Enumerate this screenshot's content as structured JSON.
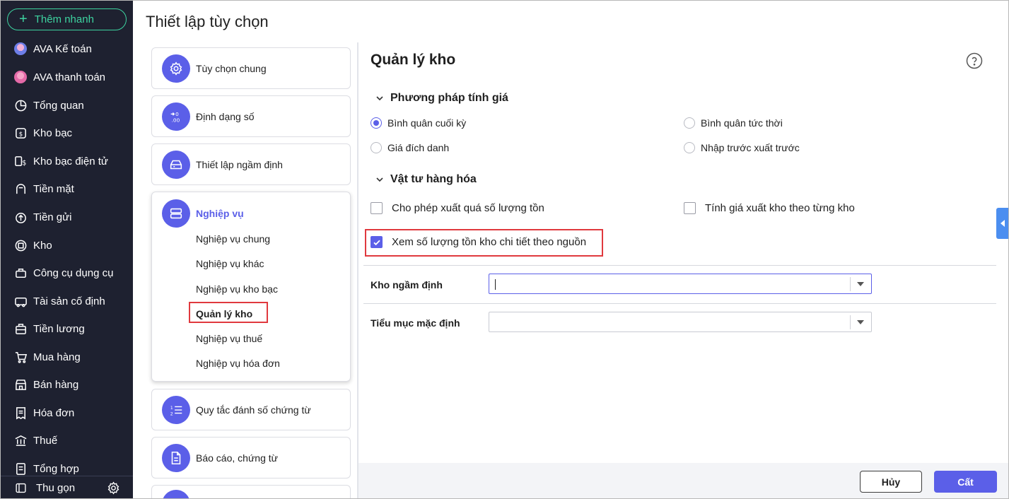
{
  "sidebar": {
    "quick_add": "Thêm nhanh",
    "items": [
      {
        "label": "AVA Kế toán",
        "icon": "ava-accounting-avatar-icon"
      },
      {
        "label": "AVA thanh toán",
        "icon": "ava-payment-avatar-icon"
      },
      {
        "label": "Tổng quan",
        "icon": "pie-chart-icon"
      },
      {
        "label": "Kho bạc",
        "icon": "treasury-coin-icon"
      },
      {
        "label": "Kho bạc điện tử",
        "icon": "e-treasury-icon"
      },
      {
        "label": "Tiền mặt",
        "icon": "cash-icon"
      },
      {
        "label": "Tiền gửi",
        "icon": "deposit-icon"
      },
      {
        "label": "Kho",
        "icon": "warehouse-icon"
      },
      {
        "label": "Công cụ dụng cụ",
        "icon": "tools-icon"
      },
      {
        "label": "Tài sản cố định",
        "icon": "fixed-asset-icon"
      },
      {
        "label": "Tiền lương",
        "icon": "salary-icon"
      },
      {
        "label": "Mua hàng",
        "icon": "cart-icon"
      },
      {
        "label": "Bán hàng",
        "icon": "store-icon"
      },
      {
        "label": "Hóa đơn",
        "icon": "invoice-icon"
      },
      {
        "label": "Thuế",
        "icon": "bank-icon"
      },
      {
        "label": "Tổng hợp",
        "icon": "summary-icon"
      }
    ],
    "collapse_label": "Thu gọn"
  },
  "page_title": "Thiết lập tùy chọn",
  "categories": [
    {
      "label": "Tùy chọn chung",
      "icon": "gear-icon"
    },
    {
      "label": "Định dạng số",
      "icon": "number-format-icon"
    },
    {
      "label": "Thiết lập ngầm định",
      "icon": "default-settings-icon"
    },
    {
      "label": "Nghiệp vụ",
      "icon": "business-icon"
    },
    {
      "label": "Quy tắc đánh số chứng từ",
      "icon": "numbered-list-icon"
    },
    {
      "label": "Báo cáo, chứng từ",
      "icon": "document-icon"
    }
  ],
  "sub_items": [
    "Nghiệp vụ chung",
    "Nghiệp vụ khác",
    "Nghiệp vụ kho bạc",
    "Quản lý kho",
    "Nghiệp vụ thuế",
    "Nghiệp vụ hóa đơn"
  ],
  "content": {
    "title": "Quản lý kho",
    "pricing_section": "Phương pháp tính giá",
    "pricing_options": [
      {
        "label": "Bình quân cuối kỳ",
        "checked": true
      },
      {
        "label": "Bình quân tức thời",
        "checked": false
      },
      {
        "label": "Giá đích danh",
        "checked": false
      },
      {
        "label": "Nhập trước xuất trước",
        "checked": false
      }
    ],
    "materials_section": "Vật tư hàng hóa",
    "material_options": [
      {
        "label": "Cho phép xuất quá số lượng tồn",
        "checked": false
      },
      {
        "label": "Tính giá xuất kho theo từng kho",
        "checked": false
      },
      {
        "label": "Xem số lượng tồn kho chi tiết theo nguồn",
        "checked": true
      }
    ],
    "default_warehouse_label": "Kho ngầm định",
    "default_warehouse_value": "",
    "default_subitem_label": "Tiểu mục mặc định",
    "default_subitem_value": ""
  },
  "buttons": {
    "cancel": "Hủy",
    "save": "Cất"
  },
  "colors": {
    "accent": "#5b5fe8",
    "sidebar_bg": "#1e2130",
    "quick_add": "#3dd3a0",
    "highlight": "#e0393e"
  }
}
